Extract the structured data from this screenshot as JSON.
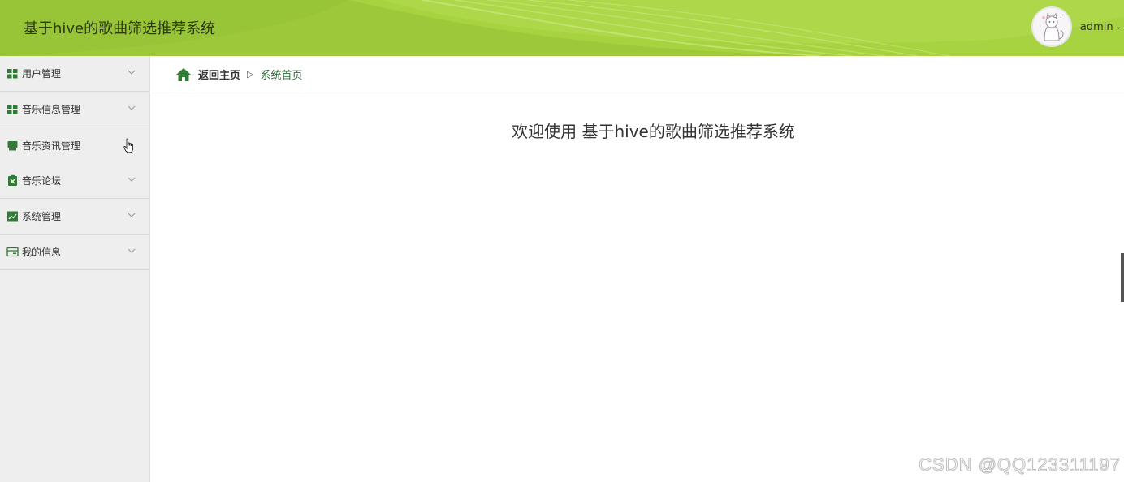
{
  "header": {
    "title": "基于hive的歌曲筛选推荐系统",
    "username": "admin",
    "caret": "⌄",
    "bg_color": "#9cc83a"
  },
  "sidebar": {
    "items": [
      {
        "label": "用户管理",
        "icon": "grid-icon",
        "has_arrow": true
      },
      {
        "label": "音乐信息管理",
        "icon": "grid-icon",
        "has_arrow": true
      },
      {
        "label": "音乐资讯管理",
        "icon": "monitor-icon",
        "has_arrow": false
      },
      {
        "label": "音乐论坛",
        "icon": "clipboard-icon",
        "has_arrow": true
      },
      {
        "label": "系统管理",
        "icon": "chart-icon",
        "has_arrow": true
      },
      {
        "label": "我的信息",
        "icon": "card-icon",
        "has_arrow": true
      }
    ]
  },
  "breadcrumb": {
    "home": "返回主页",
    "separator": "▷",
    "current": "系统首页"
  },
  "main": {
    "welcome": "欢迎使用 基于hive的歌曲筛选推荐系统"
  },
  "watermark": "CSDN @QQ123311197",
  "colors": {
    "accent_green": "#2e7d32",
    "sidebar_bg": "#eeeeee"
  }
}
